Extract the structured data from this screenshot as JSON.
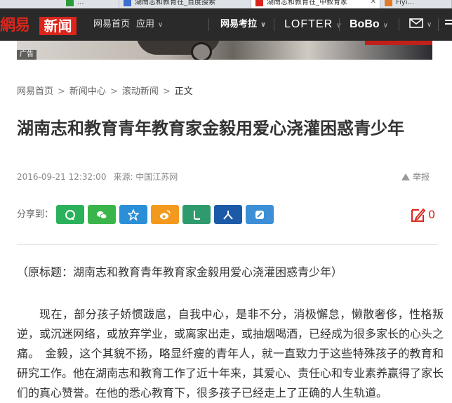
{
  "browser_tabs": [
    {
      "label": "...",
      "active": false
    },
    {
      "label": "湖南志和教育在_百度搜索",
      "active": false
    },
    {
      "label": "湖南志和教育在_中教育家",
      "active": true
    },
    {
      "label": "Fiyi...",
      "active": false
    }
  ],
  "nav": {
    "logo_wangyi": "網易",
    "logo_xinwen": "新闻",
    "home": "网易首页",
    "apps": "应用",
    "kaola": "网易考拉",
    "lofter": "LOFTER",
    "bobo": "BoBo"
  },
  "ad": {
    "label": "广告"
  },
  "breadcrumb": {
    "items": [
      "网易首页",
      "新闻中心",
      "滚动新闻",
      "正文"
    ],
    "separator": ">"
  },
  "article": {
    "title": "湖南志和教育青年教育家金毅用爱心浇灌困惑青少年",
    "date": "2016-09-21 12:32:00",
    "source": "来源: 中国江苏网",
    "report_label": "举报",
    "share_label": "分享到：",
    "comment_count": "0",
    "orig_title_line": "（原标题：湖南志和教育青年教育家金毅用爱心浇灌困惑青少年）",
    "para1": "现在，部分孩子娇惯跋扈，自我中心，是非不分，消极懈怠，懒散奢侈，性格叛逆，或沉迷网络，或放弃学业，或离家出走，或抽烟喝酒，已经成为很多家长的心头之痛。　金毅，这个其貌不扬，略显纤瘦的青年人，就一直致力于这些特殊孩子的教育和研究工作。他在湖南志和教育工作了近十年来，其爱心、责任心和专业素养赢得了家长们的真心赞誉。在他的悉心教育下，很多孩子已经走上了正确的人生轨道。"
  },
  "share_buttons": [
    {
      "name": "qq",
      "color": "#2bb15a"
    },
    {
      "name": "wechat",
      "color": "#3ab54a"
    },
    {
      "name": "qzone",
      "color": "#2b8fd8"
    },
    {
      "name": "weibo",
      "color": "#f39a1e"
    },
    {
      "name": "yixin",
      "color": "#2f9a6c"
    },
    {
      "name": "renren",
      "color": "#1c5aa8"
    },
    {
      "name": "youdao",
      "color": "#3c8fd6"
    }
  ],
  "colors": {
    "brand_red": "#d9251c",
    "navbar": "#2a2a2a"
  }
}
